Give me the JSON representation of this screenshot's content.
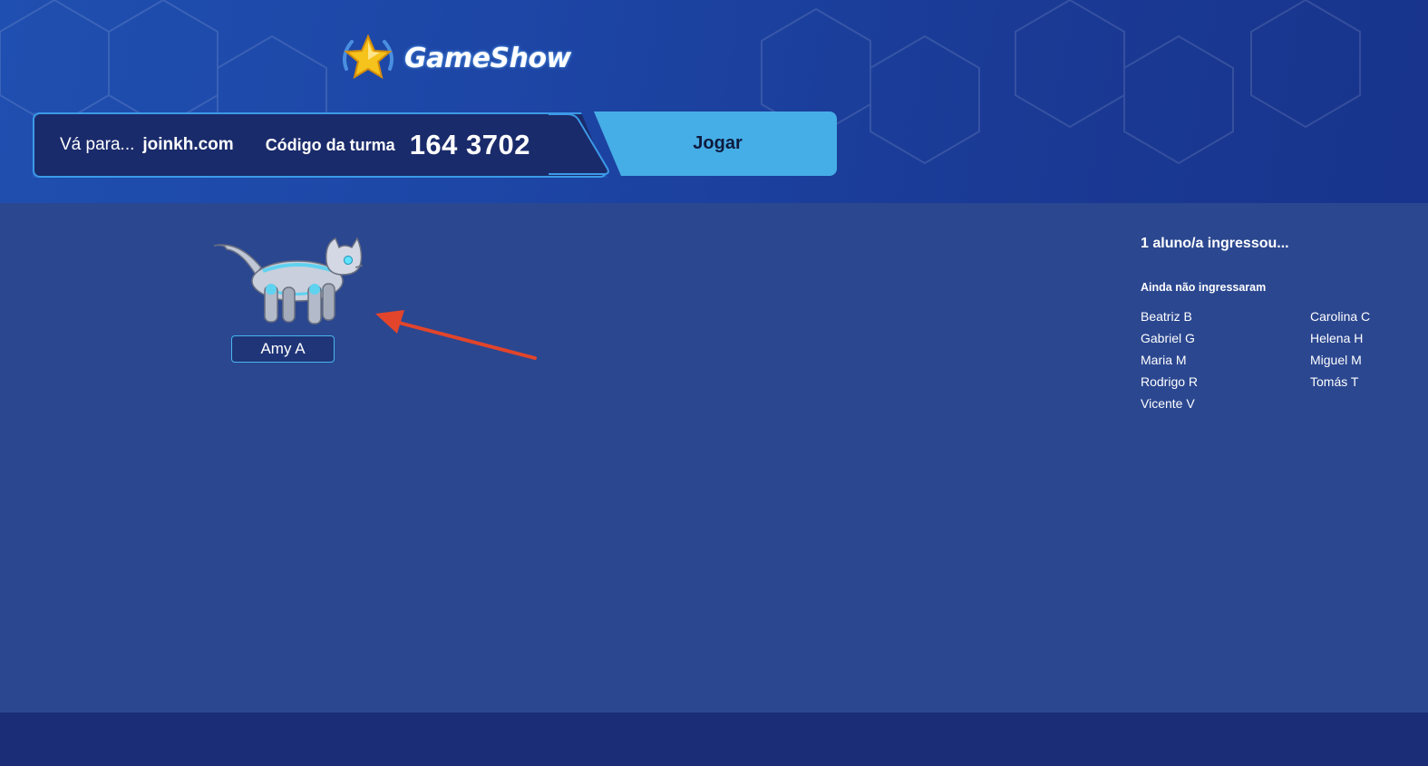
{
  "header": {
    "logo_text": "GameShow",
    "goto_label": "Vá para...",
    "goto_url": "joinkh.com",
    "class_code_label": "Código da turma",
    "class_code": "164 3702",
    "play_label": "Jogar"
  },
  "players": [
    {
      "name": "Amy A",
      "avatar": "robot-cat"
    }
  ],
  "sidebar": {
    "joined_text": "1 aluno/a ingressou...",
    "not_joined_heading": "Ainda não ingressaram",
    "not_joined": [
      "Beatriz B",
      "Carolina C",
      "Gabriel G",
      "Helena H",
      "Maria M",
      "Miguel M",
      "Rodrigo R",
      "Tomás T",
      "Vicente V"
    ]
  },
  "colors": {
    "header_bg": "#1d46a6",
    "main_bg": "#2b4790",
    "play_button": "#46aee6",
    "accent_border": "#3c9ae8",
    "arrow": "#e2452b"
  }
}
